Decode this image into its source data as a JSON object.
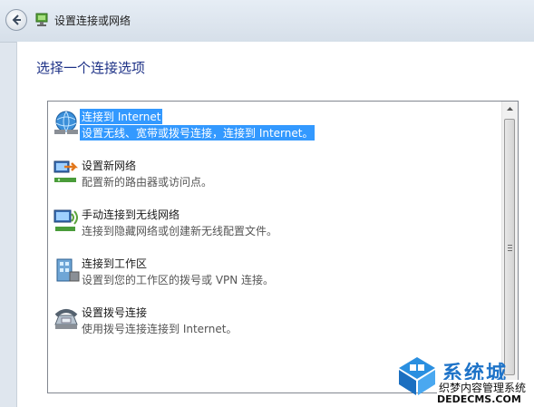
{
  "window": {
    "title": "设置连接或网络"
  },
  "main": {
    "heading": "选择一个连接选项"
  },
  "options": [
    {
      "title": "连接到 Internet",
      "description": "设置无线、宽带或拨号连接，连接到 Internet。",
      "icon": "globe-network-icon",
      "selected": true
    },
    {
      "title": "设置新网络",
      "description": "配置新的路由器或访问点。",
      "icon": "new-network-icon",
      "selected": false
    },
    {
      "title": "手动连接到无线网络",
      "description": "连接到隐藏网络或创建新无线配置文件。",
      "icon": "wireless-network-icon",
      "selected": false
    },
    {
      "title": "连接到工作区",
      "description": "设置到您的工作区的拨号或 VPN 连接。",
      "icon": "workplace-icon",
      "selected": false
    },
    {
      "title": "设置拨号连接",
      "description": "使用拨号连接连接到 Internet。",
      "icon": "dial-up-phone-icon",
      "selected": false
    }
  ],
  "watermark": {
    "name": "系统城",
    "line1": "织梦内容管理系统",
    "line2": "DEDECMS.COM"
  },
  "colors": {
    "heading": "#1e3287",
    "selection": "#3399ff"
  }
}
